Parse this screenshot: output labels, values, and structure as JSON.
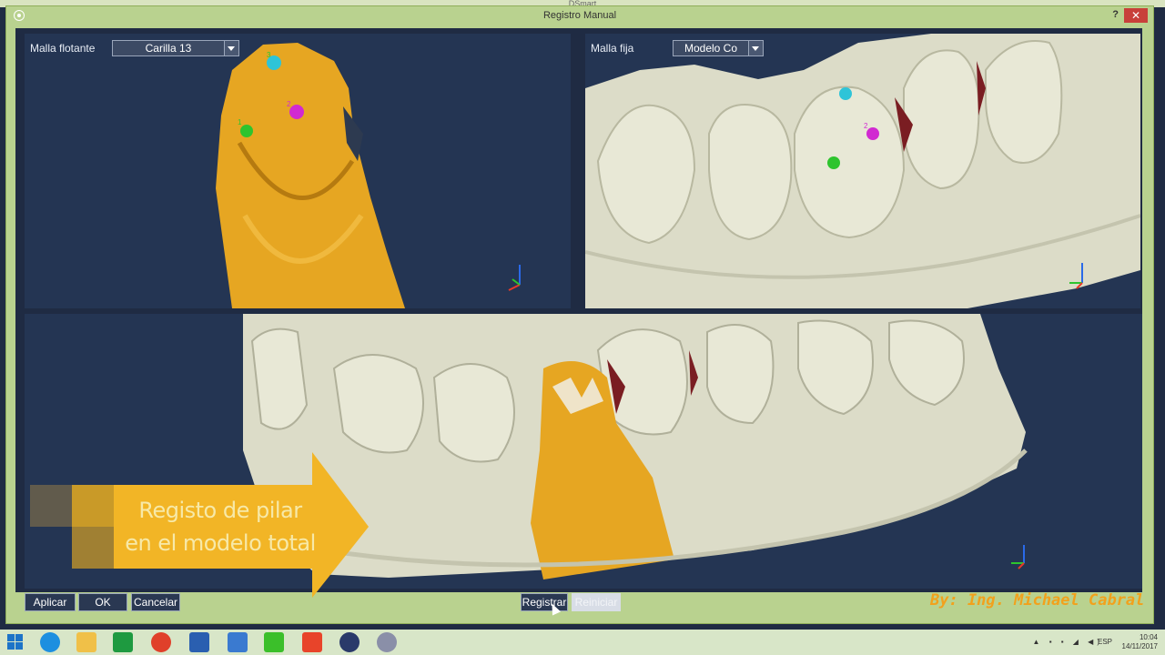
{
  "background_app": {
    "title": "DSmart"
  },
  "dialog": {
    "title": "Registro Manual",
    "help_label": "?",
    "close_label": "✕"
  },
  "floating_mesh": {
    "label": "Malla flotante",
    "selected": "Carilla 13",
    "markers": [
      "1",
      "2",
      "3"
    ]
  },
  "fixed_mesh": {
    "label": "Malla fija",
    "selected": "Modelo Co",
    "markers": [
      "1",
      "2",
      "3"
    ]
  },
  "callout": {
    "line1": "Registo de pilar",
    "line2": "en el modelo total"
  },
  "buttons": {
    "apply": "Aplicar",
    "ok": "OK",
    "cancel": "Cancelar",
    "register": "Registrar",
    "reset": "Reiniciar"
  },
  "credit": "By: Ing. Michael Cabral",
  "taskbar": {
    "language": "ESP",
    "time": "10:04",
    "date": "14/11/2017"
  },
  "colors": {
    "viewport_bg": "#243553",
    "frame_green": "#b9d28f",
    "crown_gold": "#e6a622",
    "model_ivory": "#dcdcc8",
    "callout_gold": "#f2b526",
    "marker_cyan": "#2ec4d8",
    "marker_magenta": "#d12ad1",
    "marker_green": "#2ec42e"
  }
}
